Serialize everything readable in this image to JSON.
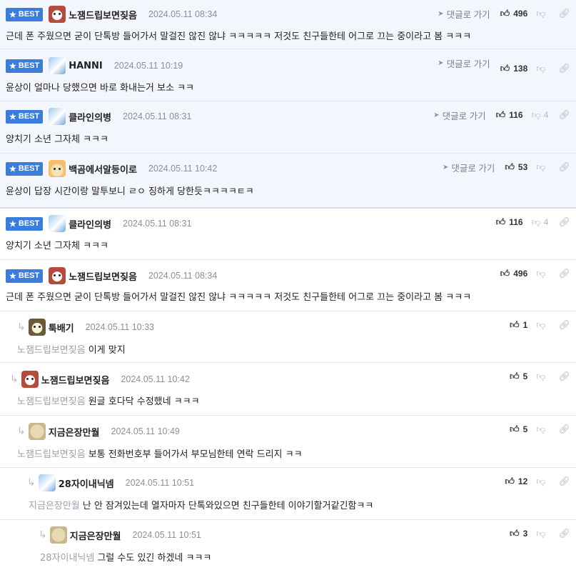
{
  "labels": {
    "best": "BEST",
    "goto": "댓글로 가기"
  },
  "best_comments": [
    {
      "nick": "노잼드립보면짖음",
      "date": "2024.05.11 08:34",
      "text": "근데 폰 주웠으면 굳이 단톡방 들어가서 말걸진 않진 않냐 ㅋㅋㅋㅋㅋ 저것도 친구들한테 어그로 끄는 중이라고 봄 ㅋㅋㅋ",
      "likes": "496",
      "dislikes": "",
      "avatar": "dog-icon"
    },
    {
      "nick": "HANNI",
      "date": "2024.05.11 10:19",
      "text": "윤상이 얼마나 당했으면 바로 화내는거 보소 ㅋㅋ",
      "likes": "138",
      "dislikes": "",
      "avatar": "bunny-icon"
    },
    {
      "nick": "클라인의병",
      "date": "2024.05.11 08:31",
      "text": "양치기 소년 그자체 ㅋㅋㅋ",
      "likes": "116",
      "dislikes": "4",
      "avatar": "bottle-icon"
    },
    {
      "nick": "백곰에서알등이로",
      "date": "2024.05.11 10:42",
      "text": "윤상이 답장 시간이랑 말투보니 ㄹㅇ 징하게 당한듯ㅋㅋㅋㅋㅌㅋ",
      "likes": "53",
      "dislikes": "",
      "avatar": "fox-icon"
    }
  ],
  "comments": [
    {
      "nick": "클라인의병",
      "date": "2024.05.11 08:31",
      "text": "양치기 소년 그자체 ㅋㅋㅋ",
      "likes": "116",
      "dislikes": "4",
      "avatar": "bottle-icon"
    },
    {
      "nick": "노잼드립보면짖음",
      "date": "2024.05.11 08:34",
      "text": "근데 폰 주웠으면 굳이 단톡방 들어가서 말걸진 않진 않냐 ㅋㅋㅋㅋㅋ 저것도 친구들한테 어그로 끄는 중이라고 봄 ㅋㅋㅋ",
      "likes": "496",
      "dislikes": "",
      "avatar": "dog-icon"
    }
  ],
  "replies": [
    {
      "nick": "툭배기",
      "date": "2024.05.11 10:33",
      "mention": "노잼드립보면짖음",
      "text": "이게 맞지",
      "likes": "1",
      "avatar": "bear-icon"
    },
    {
      "nick": "노잼드립보면짖음",
      "date": "2024.05.11 10:42",
      "mention": "노잼드립보면짖음",
      "text": "원글 호다닥 수정했네 ㅋㅋㅋ",
      "likes": "5",
      "avatar": "dog-icon"
    },
    {
      "nick": "지금은장만월",
      "date": "2024.05.11 10:49",
      "mention": "노잼드립보면짖음",
      "text": "보통 전화번호부 들어가서 부모님한테 연락 드리지 ㅋㅋ",
      "likes": "5",
      "avatar": "sheep-icon"
    },
    {
      "nick": "28자이내닉넴",
      "date": "2024.05.11 10:51",
      "mention": "지금은장만월",
      "text": "난 안 잠겨있는데 열자마자 단톡와있으면 친구들한테 이야기할거같긴함ㅋㅋ",
      "likes": "12",
      "avatar": "bottle-icon"
    },
    {
      "nick": "지금은장만월",
      "date": "2024.05.11 10:51",
      "mention": "28자이내닉넴",
      "text": "그럴 수도 있긴 하겠네 ㅋㅋㅋ",
      "likes": "3",
      "avatar": "sheep-icon"
    }
  ]
}
